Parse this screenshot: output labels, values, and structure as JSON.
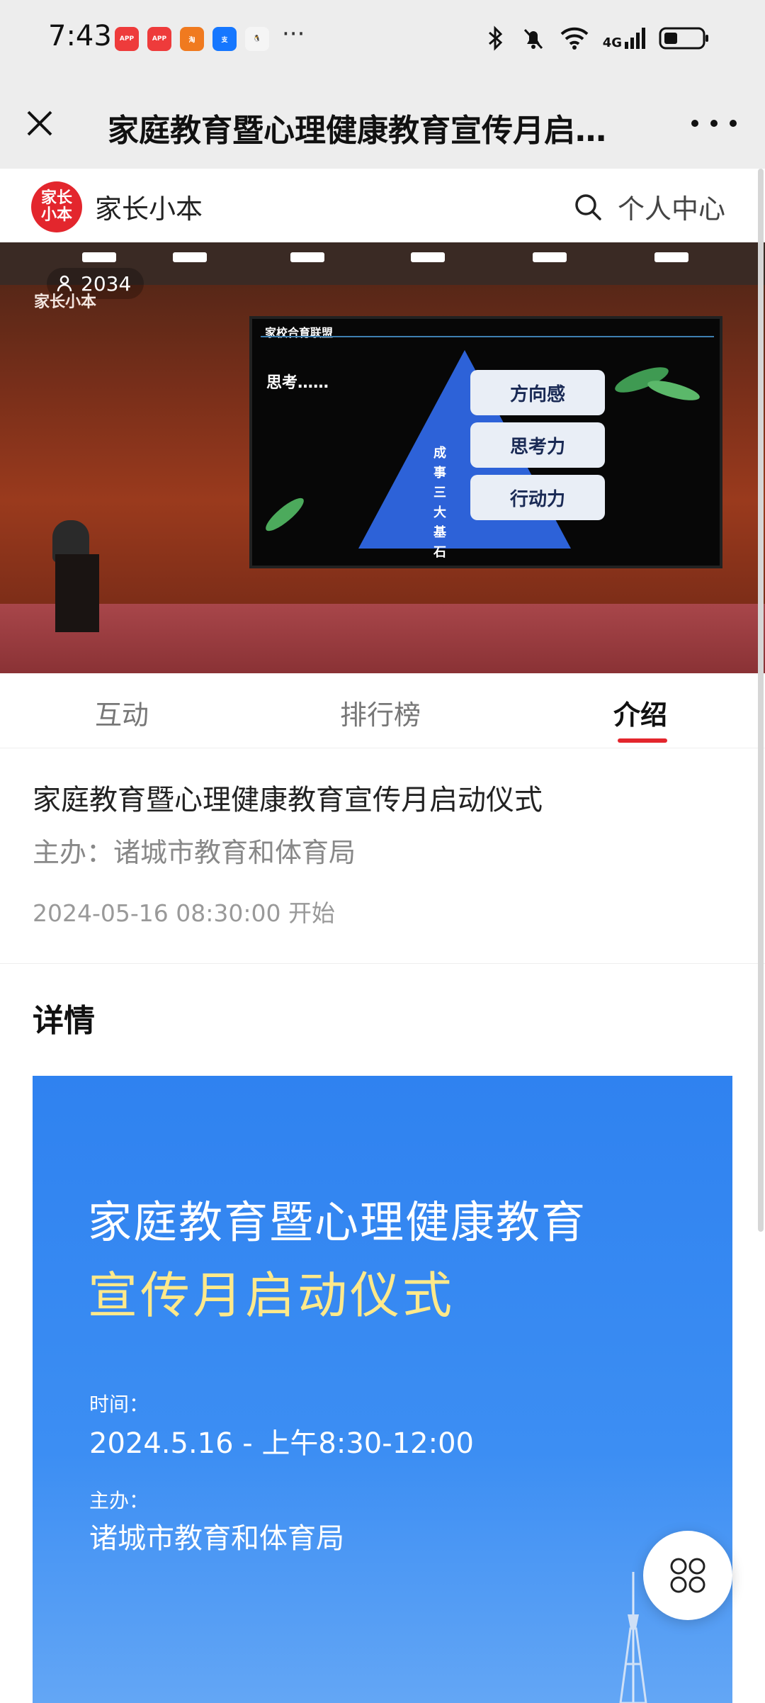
{
  "status_bar": {
    "time": "7:43",
    "apps": [
      "huawei-store-icon",
      "huawei-store-icon",
      "taobao-icon",
      "alipay-icon",
      "qq-icon"
    ],
    "more": "···",
    "network": "4G"
  },
  "nav": {
    "title": "家庭教育暨心理健康教育宣传月启…"
  },
  "site": {
    "logo_text": "家长小本",
    "brand": "家长小本",
    "personal_center": "个人中心"
  },
  "video": {
    "viewer_count": "2034",
    "watermark": "家长小本",
    "screen_header": "家校合育联盟",
    "screen_think": "思考……",
    "pyramid_label": "成事三大基石",
    "pills": [
      "方向感",
      "思考力",
      "行动力"
    ]
  },
  "tabs": {
    "items": [
      "互动",
      "排行榜",
      "介绍"
    ],
    "active": "介绍"
  },
  "intro": {
    "title": "家庭教育暨心理健康教育宣传月启动仪式",
    "organizer": "主办：诸城市教育和体育局",
    "start_time": "2024-05-16 08:30:00 开始"
  },
  "details": {
    "heading": "详情"
  },
  "poster": {
    "line1": "家庭教育暨心理健康教育",
    "line2": "宣传月启动仪式",
    "time_label": "时间：",
    "time_value": "2024.5.16 - 上午8:30-12:00",
    "host_label": "主办：",
    "host_value": "诸城市教育和体育局"
  },
  "colors": {
    "accent": "#e3262d",
    "poster_blue": "#2f82f0",
    "poster_yellow": "#ffe98a"
  }
}
